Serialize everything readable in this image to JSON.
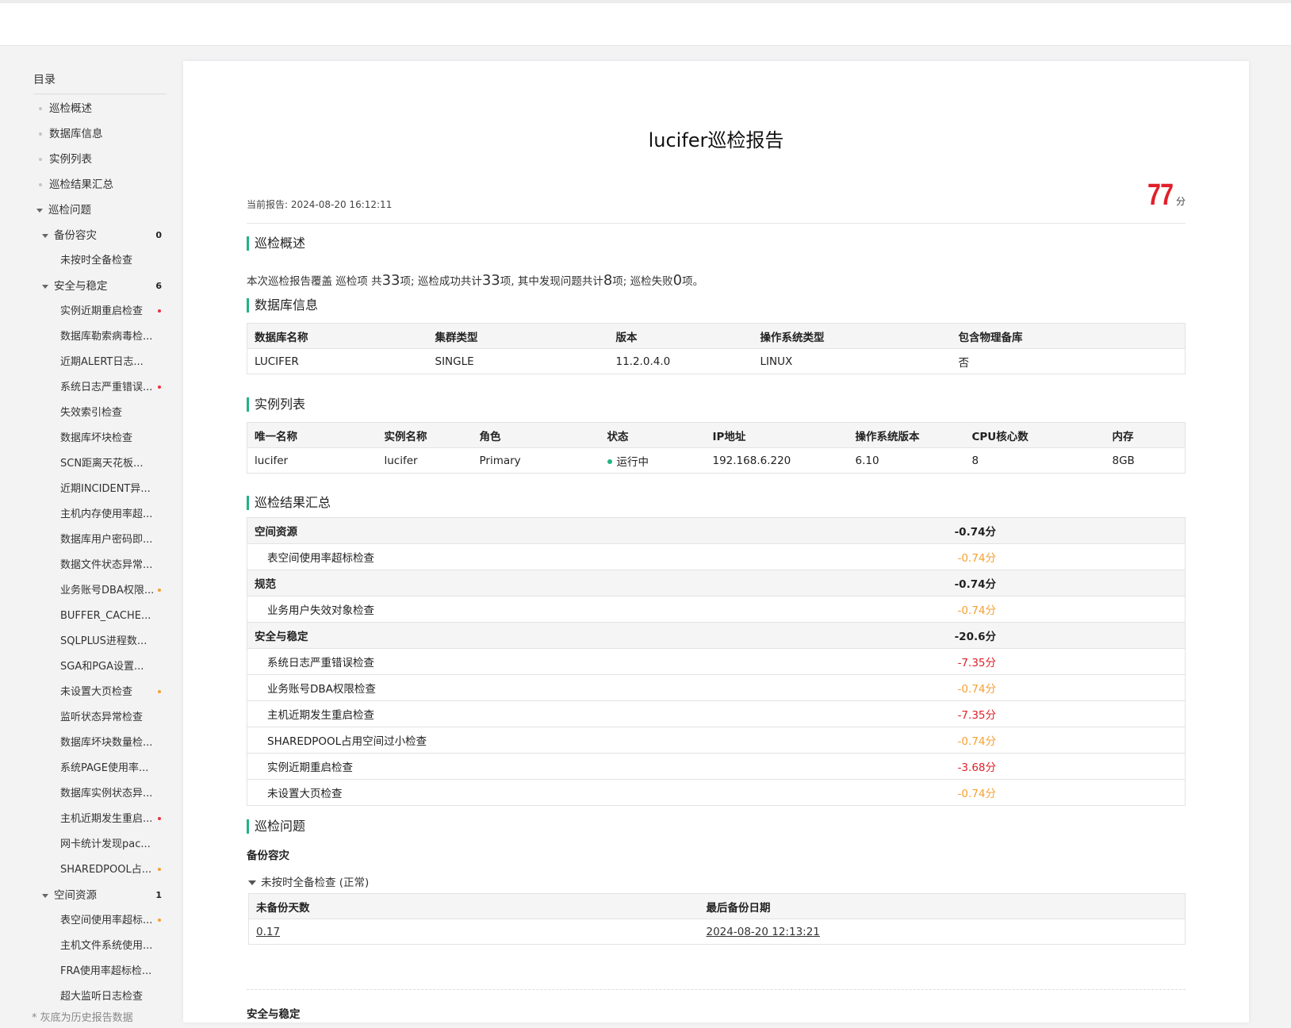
{
  "toc": {
    "title": "目录",
    "l1": {
      "overview": "巡检概述",
      "dbinfo": "数据库信息",
      "instances": "实例列表",
      "summary": "巡检结果汇总",
      "issues": "巡检问题"
    },
    "groups": [
      {
        "label": "备份容灾",
        "count": "0",
        "items": [
          {
            "label": "未按时全备检查",
            "mark": ""
          }
        ]
      },
      {
        "label": "安全与稳定",
        "count": "6",
        "items": [
          {
            "label": "实例近期重启检查",
            "mark": "red"
          },
          {
            "label": "数据库勒索病毒检...",
            "mark": ""
          },
          {
            "label": "近期ALERT日志...",
            "mark": ""
          },
          {
            "label": "系统日志严重错误...",
            "mark": "red"
          },
          {
            "label": "失效索引检查",
            "mark": ""
          },
          {
            "label": "数据库坏块检查",
            "mark": ""
          },
          {
            "label": "SCN距离天花板...",
            "mark": ""
          },
          {
            "label": "近期INCIDENT异...",
            "mark": ""
          },
          {
            "label": "主机内存使用率超...",
            "mark": ""
          },
          {
            "label": "数据库用户密码即...",
            "mark": ""
          },
          {
            "label": "数据文件状态异常...",
            "mark": ""
          },
          {
            "label": "业务账号DBA权限...",
            "mark": "orange"
          },
          {
            "label": "BUFFER_CACHE...",
            "mark": ""
          },
          {
            "label": "SQLPLUS进程数...",
            "mark": ""
          },
          {
            "label": "SGA和PGA设置...",
            "mark": ""
          },
          {
            "label": "未设置大页检查",
            "mark": "orange"
          },
          {
            "label": "监听状态异常检查",
            "mark": ""
          },
          {
            "label": "数据库坏块数量检...",
            "mark": ""
          },
          {
            "label": "系统PAGE使用率...",
            "mark": ""
          },
          {
            "label": "数据库实例状态异...",
            "mark": ""
          },
          {
            "label": "主机近期发生重启...",
            "mark": "red"
          },
          {
            "label": "网卡统计发现pac...",
            "mark": ""
          },
          {
            "label": "SHAREDPOOL占...",
            "mark": "orange"
          }
        ]
      },
      {
        "label": "空间资源",
        "count": "1",
        "items": [
          {
            "label": "表空间使用率超标...",
            "mark": "orange"
          },
          {
            "label": "主机文件系统使用...",
            "mark": ""
          },
          {
            "label": "FRA使用率超标检...",
            "mark": ""
          },
          {
            "label": "超大监听日志检查",
            "mark": ""
          }
        ]
      }
    ],
    "note": "* 灰底为历史报告数据"
  },
  "report": {
    "title": "lucifer巡检报告",
    "current_label": "当前报告:",
    "current_time": "2024-08-20 16:12:11",
    "score": "77",
    "score_unit": "分"
  },
  "overview": {
    "heading": "巡检概述",
    "t1": "本次巡检报告覆盖 巡检项 共",
    "total": "33",
    "t2": "项; 巡检成功共计",
    "success": "33",
    "t3": "项, 其中发现问题共计",
    "problems": "8",
    "t4": "项; 巡检失败",
    "failed": "0",
    "t5": "项。"
  },
  "dbinfo": {
    "heading": "数据库信息",
    "headers": [
      "数据库名称",
      "集群类型",
      "版本",
      "操作系统类型",
      "包含物理备库"
    ],
    "row": [
      "LUCIFER",
      "SINGLE",
      "11.2.0.4.0",
      "LINUX",
      "否"
    ]
  },
  "instances": {
    "heading": "实例列表",
    "headers": [
      "唯一名称",
      "实例名称",
      "角色",
      "状态",
      "IP地址",
      "操作系统版本",
      "CPU核心数",
      "内存"
    ],
    "row": [
      "lucifer",
      "lucifer",
      "Primary",
      "运行中",
      "192.168.6.220",
      "6.10",
      "8",
      "8GB"
    ]
  },
  "summary": {
    "heading": "巡检结果汇总",
    "rows": [
      {
        "type": "group",
        "name": "空间资源",
        "value": "-0.74分",
        "color": ""
      },
      {
        "type": "item",
        "name": "表空间使用率超标检查",
        "value": "-0.74分",
        "color": "orange"
      },
      {
        "type": "group",
        "name": "规范",
        "value": "-0.74分",
        "color": ""
      },
      {
        "type": "item",
        "name": "业务用户失效对象检查",
        "value": "-0.74分",
        "color": "orange"
      },
      {
        "type": "group",
        "name": "安全与稳定",
        "value": "-20.6分",
        "color": ""
      },
      {
        "type": "item",
        "name": "系统日志严重错误检查",
        "value": "-7.35分",
        "color": "red"
      },
      {
        "type": "item",
        "name": "业务账号DBA权限检查",
        "value": "-0.74分",
        "color": "orange"
      },
      {
        "type": "item",
        "name": "主机近期发生重启检查",
        "value": "-7.35分",
        "color": "red"
      },
      {
        "type": "item",
        "name": "SHAREDPOOL占用空间过小检查",
        "value": "-0.74分",
        "color": "orange"
      },
      {
        "type": "item",
        "name": "实例近期重启检查",
        "value": "-3.68分",
        "color": "red"
      },
      {
        "type": "item",
        "name": "未设置大页检查",
        "value": "-0.74分",
        "color": "orange"
      }
    ]
  },
  "issues": {
    "heading": "巡检问题",
    "group1": "备份容灾",
    "check1": "未按时全备检查 (正常)",
    "headers": [
      "未备份天数",
      "最后备份日期"
    ],
    "row": [
      "0.17",
      "2024-08-20 12:13:21"
    ],
    "group2": "安全与稳定"
  },
  "colors": {
    "accent": "#22b386",
    "red": "#e0202a",
    "orange": "#f5a033"
  }
}
